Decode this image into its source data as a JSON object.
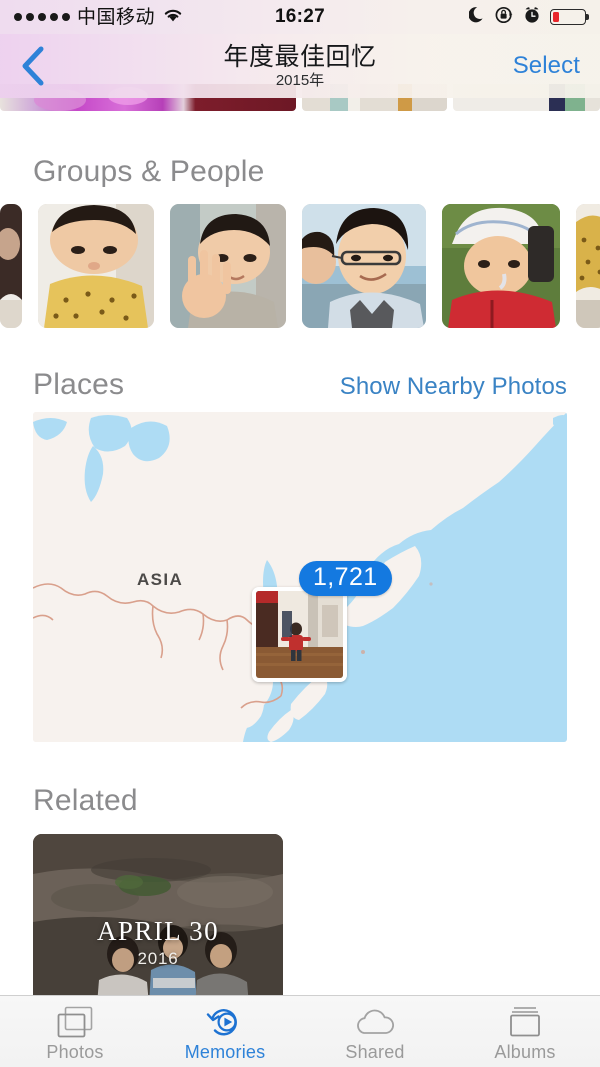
{
  "status_bar": {
    "signal_dots": 5,
    "carrier": "中国移动",
    "wifi_icon": "wifi-icon",
    "time": "16:27",
    "do_not_disturb_icon": "moon-icon",
    "rotation_lock_icon": "rotation-lock-icon",
    "alarm_icon": "alarm-clock-icon",
    "battery_icon": "battery-low-icon",
    "battery_level_pct": 22,
    "battery_color": "#e8262b"
  },
  "nav_bar": {
    "back_icon": "chevron-left-icon",
    "title": "年度最佳回忆",
    "subtitle": "2015年",
    "select_label": "Select",
    "accent_color": "#2e82d8"
  },
  "sections": {
    "groups_people": {
      "title": "Groups & People",
      "faces": [
        {
          "name": "face-thumbnail-1",
          "partial": true
        },
        {
          "name": "face-thumbnail-2",
          "partial": false
        },
        {
          "name": "face-thumbnail-3",
          "partial": false
        },
        {
          "name": "face-thumbnail-4",
          "partial": false
        },
        {
          "name": "face-thumbnail-5",
          "partial": false
        },
        {
          "name": "face-thumbnail-6",
          "partial": true
        }
      ]
    },
    "places": {
      "title": "Places",
      "link_label": "Show Nearby Photos",
      "link_color": "#3a83c4",
      "map": {
        "continent_label": "ASIA",
        "photo_count": "1,721",
        "badge_color": "#1479e0",
        "land_color": "#f7f2ee",
        "water_color": "#aedcf4",
        "border_color": "#d9a08c"
      }
    },
    "related": {
      "title": "Related",
      "cards": [
        {
          "title": "APRIL 30",
          "year": "2016"
        }
      ]
    }
  },
  "tab_bar": {
    "tabs": [
      {
        "label": "Photos",
        "icon": "photos-stack-icon",
        "active": false
      },
      {
        "label": "Memories",
        "icon": "memories-replay-icon",
        "active": true
      },
      {
        "label": "Shared",
        "icon": "cloud-icon",
        "active": false
      },
      {
        "label": "Albums",
        "icon": "albums-stack-icon",
        "active": false
      }
    ],
    "active_color": "#2e82d8",
    "inactive_color": "#9a9a9a"
  }
}
